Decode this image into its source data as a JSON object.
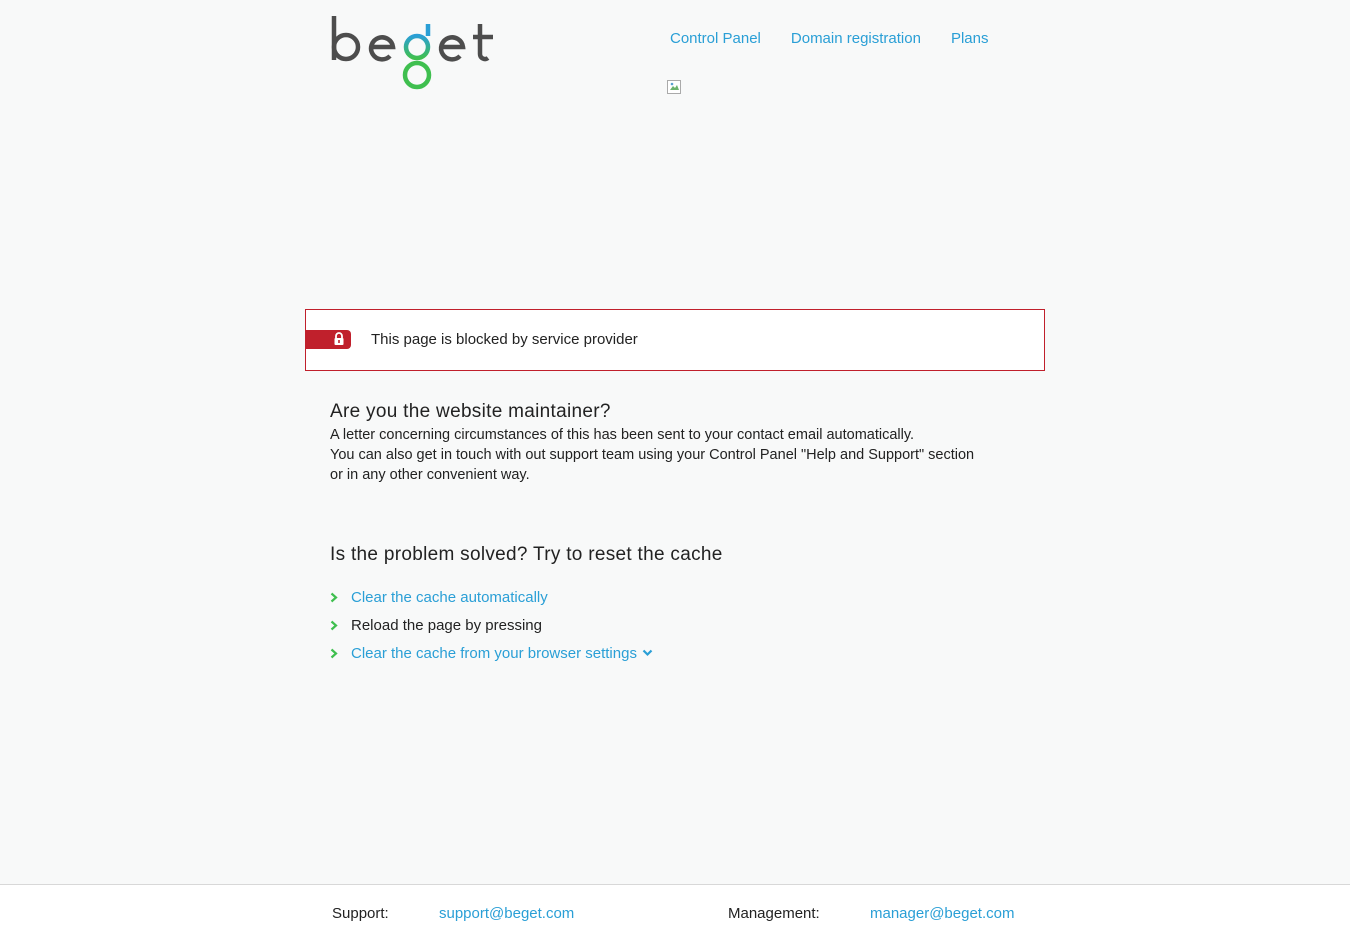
{
  "logo": {
    "text": "beget"
  },
  "nav": [
    {
      "label": "Control Panel"
    },
    {
      "label": "Domain registration"
    },
    {
      "label": "Plans"
    }
  ],
  "blocked": {
    "message": "This page is blocked by service provider"
  },
  "maintainer": {
    "heading": "Are you the website maintainer?",
    "lines": [
      "A letter concerning circumstances of this has been sent to your contact email automatically.",
      "You can also get in touch with out support team using your Control Panel \"Help and Support\" section",
      "or in any other convenient way."
    ]
  },
  "cache": {
    "heading": "Is the problem solved? Try to reset the cache",
    "items": [
      {
        "label": "Clear the cache automatically",
        "type": "link"
      },
      {
        "label": "Reload the page by pressing",
        "type": "text"
      },
      {
        "label": "Clear the cache from your browser settings",
        "type": "dropdown"
      }
    ]
  },
  "footer": {
    "support_label": "Support:",
    "support_email": "support@beget.com",
    "management_label": "Management:",
    "management_email": "manager@beget.com"
  },
  "colors": {
    "accent": "#2a9fd6",
    "alert": "#c0202c",
    "chevron": "#3fbf4f",
    "logo_gray": "#4d4d4d"
  }
}
